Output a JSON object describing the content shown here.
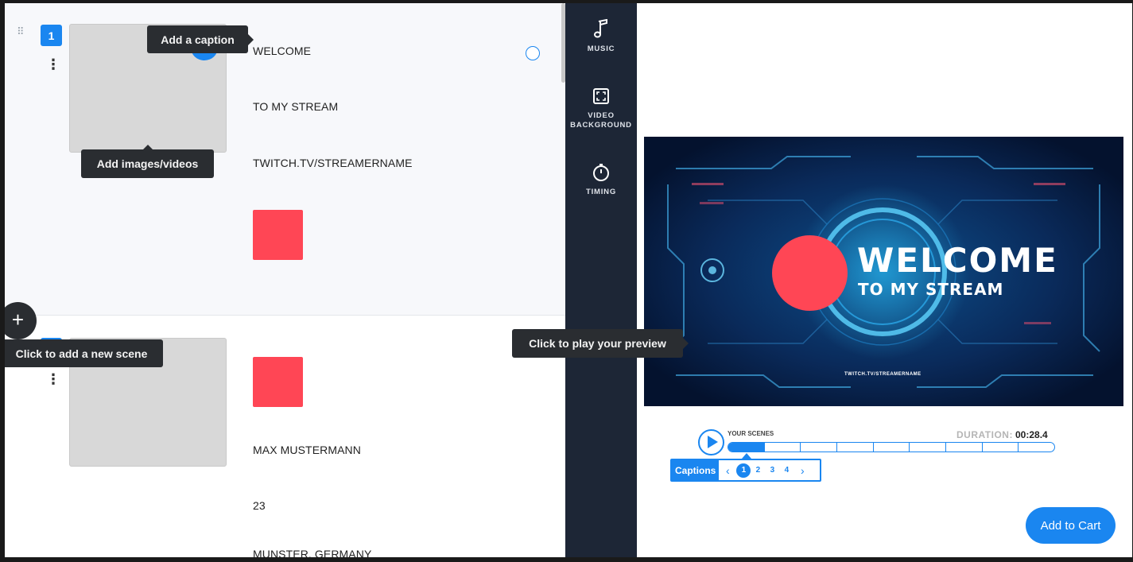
{
  "editor": {
    "scene1": {
      "number": "1",
      "captions": [
        "WELCOME",
        "TO MY STREAM",
        "TWITCH.TV/STREAMERNAME"
      ],
      "swatch_color": "#ff4655"
    },
    "scene2": {
      "captions": [
        "MAX MUSTERMANN",
        "23",
        "MUNSTER, GERMANY"
      ],
      "swatch_color": "#ff4655"
    },
    "tooltips": {
      "add_caption": "Add a caption",
      "add_media": "Add images/videos",
      "add_scene": "Click to add a new scene",
      "play_preview": "Click to play your preview"
    },
    "add_scene_symbol": "+"
  },
  "toolbar": {
    "items": [
      {
        "label": "MUSIC",
        "icon": "music-note-icon"
      },
      {
        "label_line1": "VIDEO",
        "label_line2": "BACKGROUND",
        "icon": "fullscreen-icon"
      },
      {
        "label": "TIMING",
        "icon": "stopwatch-icon"
      }
    ]
  },
  "preview": {
    "video": {
      "title": "WELCOME",
      "subtitle": "TO MY STREAM",
      "url": "TWITCH.TV/STREAMERNAME"
    },
    "your_scenes_label": "YOUR SCENES",
    "duration_label": "DURATION:",
    "duration_value": "00:28.4",
    "timeline_segments": 9,
    "active_segment": 1,
    "captions_label": "Captions",
    "caption_pages": [
      "1",
      "2",
      "3",
      "4"
    ],
    "active_page": "1",
    "prev_symbol": "‹",
    "next_symbol": "›",
    "add_to_cart": "Add to Cart"
  },
  "colors": {
    "accent": "#1a86f0",
    "toolbar_bg": "#1d2636",
    "swatch": "#ff4655"
  }
}
